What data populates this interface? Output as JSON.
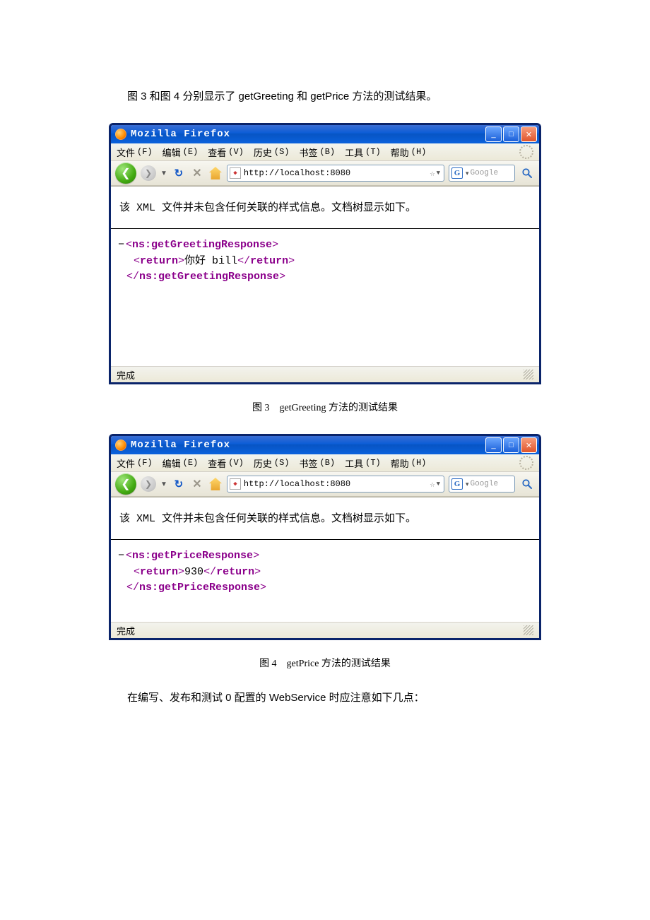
{
  "intro_text": "图 3 和图 4 分别显示了 getGreeting 和 getPrice 方法的测试结果。",
  "caption1": "图 3 getGreeting 方法的测试结果",
  "caption2": "图 4 getPrice 方法的测试结果",
  "outro_text": "在编写、发布和测试 0 配置的 WebService 时应注意如下几点：",
  "window1": {
    "title": "Mozilla Firefox",
    "menus": {
      "file": "文件",
      "file_hk": "(F)",
      "edit": "编辑",
      "edit_hk": "(E)",
      "view": "查看",
      "view_hk": "(V)",
      "history": "历史",
      "history_hk": "(S)",
      "bookmarks": "书签",
      "bookmarks_hk": "(B)",
      "tools": "工具",
      "tools_hk": "(T)",
      "help": "帮助",
      "help_hk": "(H)"
    },
    "url": "http://localhost:8080",
    "search_placeholder": "Google",
    "xml_notice": "该 XML 文件并未包含任何关联的样式信息。文档树显示如下。",
    "xml": {
      "open": "<ns:getGreetingResponse>",
      "ret_open": "<return>",
      "ret_text": "你好 bill",
      "ret_close": "</return>",
      "close": "</ns:getGreetingResponse>"
    },
    "status": "完成"
  },
  "window2": {
    "title": "Mozilla Firefox",
    "menus": {
      "file": "文件",
      "file_hk": "(F)",
      "edit": "编辑",
      "edit_hk": "(E)",
      "view": "查看",
      "view_hk": "(V)",
      "history": "历史",
      "history_hk": "(S)",
      "bookmarks": "书签",
      "bookmarks_hk": "(B)",
      "tools": "工具",
      "tools_hk": "(T)",
      "help": "帮助",
      "help_hk": "(H)"
    },
    "url": "http://localhost:8080",
    "search_placeholder": "Google",
    "xml_notice": "该 XML 文件并未包含任何关联的样式信息。文档树显示如下。",
    "xml": {
      "open": "<ns:getPriceResponse>",
      "ret_open": "<return>",
      "ret_text": "930",
      "ret_close": "</return>",
      "close": "</ns:getPriceResponse>"
    },
    "status": "完成"
  }
}
